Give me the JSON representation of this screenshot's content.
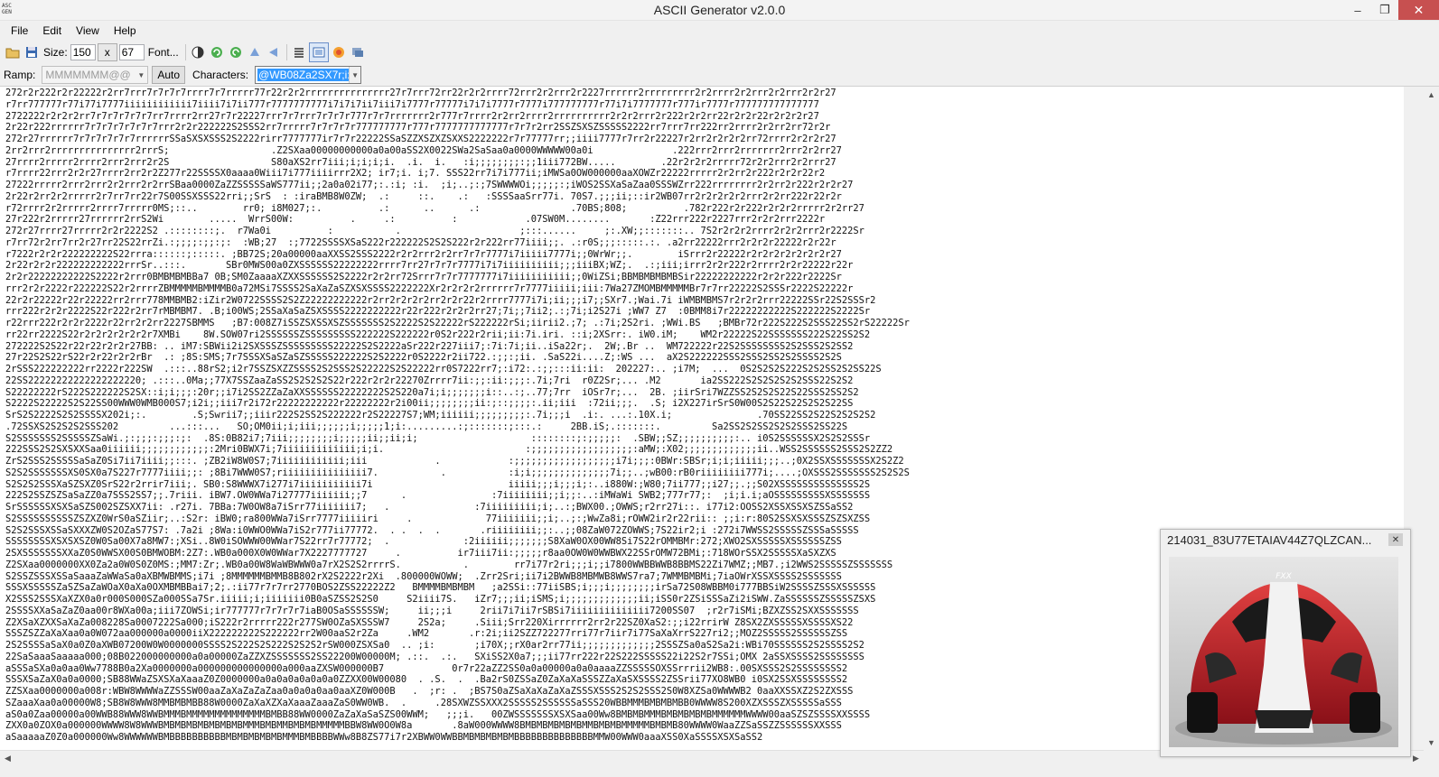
{
  "window": {
    "title": "ASCII Generator v2.0.0",
    "app_icon_text": "ASC\nGEN",
    "minimize": "–",
    "maximize": "❐",
    "close": "✕"
  },
  "menu": [
    "File",
    "Edit",
    "View",
    "Help"
  ],
  "toolbar": {
    "size_label": "Size:",
    "width": "150",
    "x_label": "x",
    "height": "67",
    "font_button": "Font..."
  },
  "toolbar2": {
    "ramp_label": "Ramp:",
    "ramp_value": "MMMMMMM@@",
    "auto_button": "Auto",
    "characters_label": "Characters:",
    "characters_value": "@WB08Za2SX7r;i:,."
  },
  "ascii_output": "272r2r222r2r22222r2rr7rrr7r7r7r7rrrr7r7rrrrr77r22r2r2rrrrrrrrrrrrrrr27r7rrr72rr22r2r2rrrr72rrr2r2rrr2r2227rrrrrr2rrrrrrrrr2r2rrrr2r2rrr2r2rrr2r2r27\nr7rr777777r77i77i7777iiiiiiiiiiii7iiii7i7ii777r7777777777i7i7i7ii7iii7i7777r77777i7i7i7777r7777i777777777r77i7i7777777r777ir7777r777777777777777\n2722222r2r2r2rr7r7r7r7r7r7rr7rrrr2rr27r7r22227rrr7r7rrr7r7r7r777r7r7rrrrrrr2r777r7rrrr2r2rr2rrrr2rrrrrrrrrr2r2r2rrr2r222r2r2rr22r2r2r22r2r2r2r27\n2r22r222rrrrrr7r7r7r7r7r7r7rrr2r2r222222S2SSS2rr7rrrrr7r7r7r7r777777777r777r7777777777777r7r7r2rr2SSZSXSZSSSSS2222rr7rrr7rr222rr2rrrr2r2rr2rr72r2r\n272r27rrrrrr7r7r7r7r7r7rrrrrrSSaSXSXSSS2S2222rirr7777777ir7r7r22222SSaSZZXSZXZSXXS2222222r7r77777rr;;iiii7777r7rr2r22227r2rr2r2r2r2rr72rrrr2r2r2r27\n2rr2rrr2rrrrrrrrrrrrrrr2rrrS;                  .Z2SXaa00000000000a0a00aSS2X0022SWa2SaSaa0a0000WWWWW00a0i              .222rrr2rrr2rrrrrrr2rrr2r2rr27\n27rrrr2rrrrr2rrrr2rrr2rrr2r2S                  S80aXS2rr7iii;i;i;i;i.  .i.  i.   :i;;;;;;;;:;;1iii772BW.....        .22r2r2r2rrrrr72r2r2rrr2r2rrr27\nr7rrrr22rrr2r2r27rrrr2rr2r2Z277r22SSSSX0aaaa0Wiii7i777iiiirrr2X2; ir7;i. i;7. SSS22rr7i7i777ii;iMWSa0OW000000aaXOWZr22222rrrrr2r2rr2r222r2r2r22r2\n27222rrrrr2rrr2rrr2r2rrr2r2rrSBaa0000ZaZZSSSSSaWS777ii;;2a0a02i77;:.:i; :i.  ;i;..;:;7SWWWWOi;;;;;:;iWOS2SSXaSaZaa0SSSWZrr222rrrrrrrr2r2rr2r222r2r2r27\n2r22r2rr2r2rrrrr2r7rr7rr22r7S00SSXSSS22rri;;SrS  : :iraBMB8W0ZW;  .:     ::.    .:   :SSSSaaSrr77i. 70S7.;;;ii;::ir2WB07rr2r2r2r2r2rrr2r2rr222r22r2r\nr72rrrr2r2rrrrr2rrrr7rrrrr0MS;::..        rr0; i8M027;:.          .:      ..      .:                .70BS;808;          .782r222r2r222r2r2r2rrrrr2r2rr27\n27r222r2rrrrr27rrrrrr2rrS2Wi        .....  WrrS00W:          .     .:          :            .07SW0M........       :Z22rrr222r2227rrr2r2r2rrr2222r\n272r27rrrr27rrrrr2r2r2222S2 .::::::::;.  r7Wa0i          :           .                     ;:::......     ;:.XW;;:::::::.. 7S2r2r2r2rrrr2r2r2rrr2r2222Sr\nr7rr72r2rr7rr2r27rr22S22rrZi.:;;;;:;;:;:  :WB;27  :;7722SSSSXSaS222r222222S2S2S222r2r222rr77iiii;;. .:r0S;;;:::::.:. .a2rr22222rrr2r2r2r22222r2r22r\nr7222r2r2r222222222S22rrra::::::;:::::. ;BB72S;20a00000aaXXSS2SSS2222r2r2rrr2r2rr7r7r7777i7iiiii7777i;;0WrWr;;.        iSrrr2r22222r2r2r2r2r2r2r2r27\n2r22r2r2r222222222222rrrSr..:::.       SBr0MWS00a0ZXSSSSSS22222222rrrr7rr27r7r7r7777i7i7iiiiiiiiii;;;iiiBX;WZ;.  .:;iii;irrr2r2r222r2rrrr2r2r22222r22r\n2r2r22222222222S2222r2rrr0BMBMBMBBa7 0B;SM0ZaaaaXZXXSSSSSS2S2222r2r2rr72Srrr7r7r7777777i7iiiiiiiiiii;;0WiZSi;BBMBMBMBMBSir22222222222r2r2r222r2222Sr\nrrr2r2r2222r222222S22r2rrrrZBMMMMMBMMMMB0a72MSi7SSSS2SaXaZaSZXSXSSSS2222222Xr2r2r2r2rrrrrr7r7777iiiii;iii:7Wa27ZMOMBMMMMMBr7r7rr22222S2SSSr2222S22222r\n22r2r22222r22r22222rr2rrr778MMBMB2:iZir2W0722SSSS2S2Z22222222222r2rr2r2r2r2rr2r2r22r2rrrr7777i7i;ii;;;i7;;SXr7.;Wai.7i iWMBMBMS7r2r2r2rrr22222SSr22S2SSSr2\nrrr222r2r2r2222S22r222r2rr7rMBMBM7. .B;i00WS;2SSaXaSaZSXSSSS2222222222r22r222r2r2r2rr27;7i;;7ii2;.:;7i;i2S27i ;WW7 Z7  :0BMM8i7r22222222222S222222S2222Sr\nr22rrr222r2r2r2222r22rr2r2rr2227SBMMS   ;B7:008Z7iSSZSXSSXSZSSSSSSS2S2222S2S22222rS222222rSi;iirii2.;7; .:7i;2S2ri. ;WWi.BS   ;BMBr72r222S222S2SSS22SS2rS22222Sr\nrr22rr2222S22r2r2r2r2r2r2r7XMBi    8W.SOW07ri2SSSSSSZSSSSSSSSS222222S222222r0S2r222r2rii;ii:7i.iri. ::i;2XSrr:. iW0.iM;    WM2r22222S22SSSSSSS222S22SS2S2\n272222S2S22r22r22r2r2r27BB: .. iM7:SBWii2i2SXSSSZSSSSSSSSS22222S2S2222aSr222r227iii7;:7i:7i;ii..iSa22r;.  2W;.Br ..  WM722222r22S2SSSSSSSS2S2SSS2S2SS2\n27r22S2S22rS22r2r22r2r2rBr  .: ;8S:SMS;7r7SSSXSaSZaSZSSSSS222222S2S2222r0S2222r2ii722.:;;:;ii. .SaS22i....Z;:WS ...  aX2S222222SSS2SSS2SS2S2SSSS2S2S\n2rSSS222222222rr2222r222SW  .:::..88rS2;i2r7SSZSXZZSSSS2S2SSS2S22222S2S22222rr0S7222rr7;:i72:.:;;:::ii:ii:  202227:.. ;i7M;  ...  0S2S2S2S222S2S2SS2S2SS22S\n22SS22222222222222222220; .:::..0Ma;;77X7SSZaaZaSS2S2S2S2S22r222r2r2r22270Zrrrr7ii:;;:ii:;;;:.7i;7ri  r0Z2Sr;... .M2       ia2SS222S2S2S2S2S2SSS22S2S2\nS22222222rS222S222222S2SX::i;i;;;:20r;;i7i2SS2ZZaZaXXSSSSSS22222222S2S220a7i;i;;;;;;;i::..:;..77;7rr  iOSr7r;...  2B. ;iirSri7WZZSS2S2S2S22S22SSS2SS2S2\nS2222S22222S2S22SS00WWW0WMB000S7;i2i;;iii7r2i72r22222222222r22222222r2i00ii;;;;;;;;ii:;::;;;;:.ii;iii  :72ii;;;.  .S; i2X227irSrS0W00S2S22S22S2S2S22SS\nSrS2S2222S2S2SSSSX202i;:.        .S;Swrii7;;iiir222S2SS2S222222r2S22227S7;WM;iiiiii;;;;;;;;;:.7i;;;i  .i:. ...:.10X.i;               .70SS22SS2S22S2S2S2S2\n.72SSXS2S2S2S2SSS202         ...:::...   SO;OM0ii;i;iii;;;;;;i;;;;;1;i:.........:;:::::::;:::.:     2BB.iS;.:::::::.         Sa2SS2S2SS2S2S2SSS2SS22S\nS2SSSSSSS2SSSSSZSaWi.;:;;;:;;;:;:  .8S:0B82i7;7iii;;;;;;;;i;;;;;ii;;ii;i;                    ::::::::;:;;;;;:  .SBW;;SZ;;;;;;;;;;:.. i0S2SSSSSSX2S2S2SSSr\n222SSS2S2SXSXXSaa0iiiiii;;;;;;;;;;;;:2Mri0BWX7i;7iiiiiiiiiiiii;i;i.                         :;;;;;;;;;;;;;;;;;;:aMW;:X02;;;;;;;;;;;;;ii..WSS2SSSSSS2SSS2S2ZZ2\nZrS2SSS2SSSSSaSaZ0Si7ii7iiii;;:::. ;ZB2iW8W0S7;7iiiiiiiiiiii;iii            .            :;;;;;;;;;;;;;;;;;;i7i;;;:0BWr:SBSr;i;i;iiiii;;;..;0X2SSXSSSSSSSX2S2Z2\nS2S2SSSSSSSXS0SX0a7S227r7777iiii;;: ;8Bi7WWW0S7;riiiiiiiiiiiiiii7.           .           :i;i;;;;;;;;;;;;;;7i;;..;wB00:rB0riiiiiiii777i;....;OXSSS2SSSSSSS2S2S2S\nS2S2S2SSSXaSZSXZ0SrS22r2rrir7iii;. SB0:S8WWWX7i277i7iiiiiiiiiii7i                        iiiii;;;i;;;i;:..i880W:;W80;7ii777;;i27;;.;;S02XSSSSSSSSSSSSSS2S\n222S2SSZSZSaSaZZ0a7SSS2SS7;;.7riii. iBW7.OW0WWa7i27777iiiiiii;;7      .               :7iiiiiiii;;i;;:..:iMWaWi SWB2;777r77;:  ;i;i.i;aOSSSSSSSSSXSSSSSSS\nSrSSSSSSXSXSaSZS002SZSXX7ii: .r27i. 7BBa:7W0OW8a7iSrr77iiiiiii7;   .               :7iiiiiiiii;i;..:;BWX00.;OWWS;r2rr27i::. i77i2:OOSS2XSSXSSXSZSSaSS2\nS2SSSSSSSSSSZSZXZ0WrS0aSZiir;..:S2r: iBW0;ra800WWa7iSrr7777iiiiiri     .             77iiiiiii;;i;..;:;WwZa8i;rOWW2ir2r22rii:: ;;i:r:80S2SSXSXSSSZSZSXZSS\nS2S2SSSXSSaSXXXZW0S2OZaS77S7: .7a2i ;8Wa:i0WWO0WWa7iS2r777ii77772.  . .  .  .       .riiiiiiii;;:..;;08ZaW072ZOWWS;7S22ir2;i :272i7WWSS2SSSSSZSSSaSSSSS\nSSSSSSSSXSXSXSZ0W0Sa00X7a8MW7:;XSi..8W0iSOWWW00WWar7S22rr7r77772;  .             :2iiiiii;;;;;;;S8XaW0OX00WW8Si7S22rOMMBMr:272;XWO2SXSSSSSXSSSSSSZSS\n2SXSSSSSSSXXaZ0S0WWSX00S0BMWOBM:2Z7:.WB0a000X0W0WWar7X2227777727     .          ir7iii7ii:;;;;;r8aa0OW0W0WWBWX22SSrOMW72BMi;:718WOrSSX2SSSSSXaSXZXS\nZ2SXaa0000000XX0Za2a0W0S0Z0MS:;MM7:Zr;.WB0a00W8WaWBWWW0a7rX2S2S2rrrrS.           .        rr7i77r2ri;;;i;;i7800WWBBWWB8BBMS22Zi7WMZ;;MB7.;i2WWS2SSSSSZSSSSSSS\nS2SSZSSSXSSaSaaaZaWWaSa0aXBMWBMMS;i7i ;8MMMMMMBMMB8B802rX2S2222r2Xi  .800000WOWW;  .Zrr2Sri;ii7i2BWWB8MBMWB8WWS7ra7;7WMMBMBMi;7iaOWrXSSXSSSS2SSSSSSS\nSSSXSSSSSZaSZSaZaWOaX0aXa0OXMBMBBai7;2;.:ii77r7r7rr2770BOS2ZSS22222Z2   BMMMMBMBMBM   ;a2SSi::77iiSBS;i;;;i;;;;;;;;irSa72S08WBBM0i777BBSiW2SSSSZSSSXSSSSSS\nX2SSS2SSSXaXZX0a0r000S000SZa000SSa7Sr.iiiii;i;iiiiiii0B0aSZSS2S2S0     S2iiii7S.   iZr7;;;ii;iSMS;i;;;;;;;;;;;;;ii;iSS0r2ZSiSSSaZi2iSWW.ZaSSSSSSZSSSSSZSXS\n2SSSSXXaSaZaZ0aa00r8WXa00a;iii7ZOWSi;ir777777r7r7r7r7iaB0OSaSSSSSSW;     ii;;;i     2rii7i7ii7rSBSi7iiiiiiiiiiiiii7200SS07  ;r2r7iSMi;BZXZSS2SXXSSSSSSS\nZ2XSaXZXXSaXaZa008228Sa0007222Sa000;iS222r2rrrrr222r277SW0OZaSXSSSW7     2S2a;     .Siii;Srr220Xirrrrrr2rr2r22SZ0XaS2:;;i22rrirW Z8SX2ZXSSSSSXSSSSXS22\nSSSZSZZaXaXaa0a0W072aa000000a0000iiX222222222S222222rr2W00aaS2r2Za     .WM2       .r:2i;ii2SZZ722277rri77r7iir7i77SaXaXrrS227ri2;;MOZ2SSSSS2SSSSSSZSS\n2S2SSSSaSaX0a0Z0aXWB07200W0W0000000SSSS2S222S2S222S2S2S2rSW000ZSXSa0  .. ;i:       ;i70X;;rX0ar2rr77ii;;;;;;;;;;;;;2SSSZSa0aS2Sa2i:WBi70SSSSSS2S2SSSS2S2\n22SaSaaaSaaaaa000;08B022000000000a0a00000ZaZZXZSSSSSSS2SS22200W00000M; .::.  .:.   SXiSS2X0a7;;;ii77rr222r22S222SSSSS22i22S2r7SSi;OMX 2aSSXSSSS2SSSSSSSS\naSSSaSXa0a0aa0Ww7788B0a2Xa0000000a000000000000000a000aaZXSW000000B7            0r7r22aZZ2SS0a0a00000a0a0aaaaZZSSSSSOXSSrrrii2WB8:.00SXSSS2S2SSSSSSSS2\nSSSXSaZaX0a0a0000;SB88WWaZSXSXaXaaaZ0Z0000000a0a0a0a0a0a0a0ZZXX00W00080  . .S.  .  .Ba2rS0ZSSaZ0ZaXaXaSSSZZaXaSXSSSS2ZSSrii77XO8WB0 i0SX2SSXSSSSSSSS2\nZZSXaa0000000a008r:WBW8WWWWaZZSSSW00aaZaXaZaZaZaa0a0a0a0aa0aaXZ0W000B   .  ;r: .  ;BS7S0aZSaXaXaZaXaZSSSXSSS2S2S2SSS2S0W8XZSa0WWWWB2 0aaXXSSXZ2S2ZXSSS\nSZaaaXaa0a00000W8;SB8W8WWW8MMBMBMBB88W0000ZaXaXZXaXaaaZaaaZaS0WW0WB.  .     .28SXWZSSXXX2SSSSS2SSSSSSaSSS20WBBMMMBMBMBMBB0WWWW8S200XZXSSSZXSSSSSaSSS\naS0a0Zaa00000a00WWB88WWW8WWBMMMBMMMMMMMMMMMMMMBMBB88WW0000ZaZaXaSaSZS00WWM;   ;;;i.   00ZWSSSSSSSXSXSaa00Ww8BMBMBMMMBMBMBMBMBMMMMMMWWWW00aaSZSZSSSSXXSSSS\nZXX0a0ZOX0a000000WWWW8W8WWWBMBMBMBMBMBMBMBMMMBMBMMBMBMBMMMMMBBW8WW0O0W8a       .8aW000WWWW8BMBMBMBMBMBMMBMBMBMMMMMBMBMB80WWWW0WaaZZSaSSZZSSSSSSXXSSS\naSaaaaaZ0Z0a000000Ww8WWWWWWBMBBBBBBBBBBMBMBMBMBMBMMMBMBBBBWWw8B8ZS77i7r2XBWW0WWBBMBMBMBMBMBBBBBBBBBBBBBBMMW00WWW0aaaXSS0XaSSSSXSXSaSS2",
  "preview": {
    "title": "214031_83U77ETAIAV44Z7QLZCAN...",
    "close": "✕"
  },
  "colors": {
    "accent_selection": "#3399ff",
    "close_button": "#c75050",
    "car_red": "#c8202a"
  }
}
